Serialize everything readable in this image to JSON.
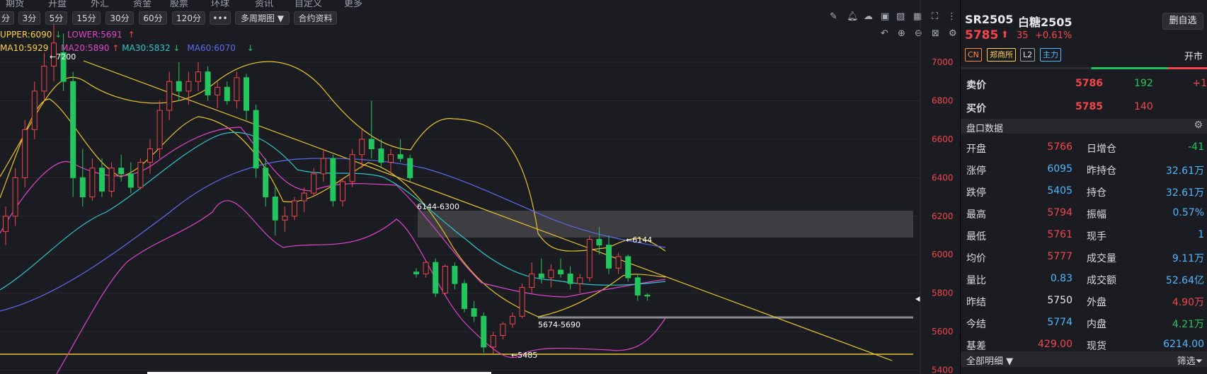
{
  "top_menu": [
    "期货",
    "开盘",
    "外汇",
    "资金",
    "股票",
    "环球",
    "资讯",
    "自定义",
    "更多"
  ],
  "toolbar": {
    "periods": [
      "分",
      "3分",
      "5分",
      "15分",
      "30分",
      "60分",
      "120分"
    ],
    "more": "•••",
    "multi_period": "多周期图 ▼",
    "contract_info": "合约资料"
  },
  "indicators": {
    "boll": [
      {
        "text": "UPPER:6090",
        "arrow": "↓",
        "color": "#ffd23f"
      },
      {
        "text": "LOWER:5691",
        "arrow": "↑",
        "color": "#e045c8"
      }
    ],
    "ma": [
      {
        "text": "MA10:5929",
        "arrow": "↓",
        "color": "#ffd23f"
      },
      {
        "text": "MA20:5890",
        "arrow": "↑",
        "color": "#e045c8"
      },
      {
        "text": "MA30:5832",
        "arrow": "↓",
        "color": "#2ec4c9"
      },
      {
        "text": "MA60:6070",
        "arrow": "↓",
        "color": "#5a6cf0"
      }
    ]
  },
  "annotations": {
    "high": "7200",
    "zone1": "6144-6300",
    "peak": "6144",
    "zone2": "5674-5690",
    "low": "5485"
  },
  "chart_data": {
    "type": "candlestick",
    "symbol": "SR2505",
    "y_axis_ticks": [
      7000,
      6800,
      6600,
      6400,
      6200,
      6000,
      5800,
      5600,
      5400
    ],
    "ylim": [
      5380,
      7250
    ],
    "candles": [
      [
        6120,
        6250,
        6050,
        6200
      ],
      [
        6200,
        6450,
        6150,
        6400
      ],
      [
        6400,
        6700,
        6350,
        6650
      ],
      [
        6650,
        6900,
        6600,
        6850
      ],
      [
        6850,
        7050,
        6800,
        6980
      ],
      [
        6980,
        7200,
        6900,
        7100
      ],
      [
        7050,
        7150,
        6850,
        6900
      ],
      [
        6900,
        6950,
        6300,
        6400
      ],
      [
        6400,
        6550,
        6250,
        6300
      ],
      [
        6300,
        6500,
        6280,
        6450
      ],
      [
        6450,
        6500,
        6300,
        6330
      ],
      [
        6330,
        6480,
        6300,
        6450
      ],
      [
        6450,
        6520,
        6380,
        6420
      ],
      [
        6420,
        6480,
        6320,
        6350
      ],
      [
        6350,
        6500,
        6340,
        6480
      ],
      [
        6480,
        6600,
        6420,
        6550
      ],
      [
        6550,
        6800,
        6500,
        6750
      ],
      [
        6750,
        6950,
        6700,
        6900
      ],
      [
        6900,
        7000,
        6800,
        6850
      ],
      [
        6850,
        6950,
        6780,
        6900
      ],
      [
        6900,
        7000,
        6850,
        6950
      ],
      [
        6950,
        6980,
        6800,
        6830
      ],
      [
        6830,
        6900,
        6760,
        6870
      ],
      [
        6870,
        6900,
        6780,
        6800
      ],
      [
        6800,
        6950,
        6760,
        6920
      ],
      [
        6920,
        6940,
        6700,
        6750
      ],
      [
        6750,
        6780,
        6400,
        6450
      ],
      [
        6450,
        6500,
        6250,
        6300
      ],
      [
        6300,
        6350,
        6100,
        6180
      ],
      [
        6180,
        6250,
        6120,
        6200
      ],
      [
        6200,
        6300,
        6180,
        6280
      ],
      [
        6280,
        6350,
        6220,
        6320
      ],
      [
        6320,
        6450,
        6300,
        6420
      ],
      [
        6420,
        6550,
        6380,
        6500
      ],
      [
        6500,
        6520,
        6250,
        6280
      ],
      [
        6280,
        6400,
        6250,
        6380
      ],
      [
        6380,
        6550,
        6350,
        6520
      ],
      [
        6520,
        6650,
        6450,
        6600
      ],
      [
        6600,
        6800,
        6500,
        6550
      ],
      [
        6550,
        6600,
        6450,
        6480
      ],
      [
        6480,
        6550,
        6420,
        6520
      ],
      [
        6520,
        6600,
        6480,
        6500
      ],
      [
        6500,
        6520,
        6380,
        6400
      ],
      [
        5910,
        5930,
        5880,
        5900
      ],
      [
        5900,
        5970,
        5880,
        5960
      ],
      [
        5960,
        5980,
        5780,
        5800
      ],
      [
        5800,
        5950,
        5790,
        5940
      ],
      [
        5940,
        5960,
        5820,
        5850
      ],
      [
        5850,
        5870,
        5700,
        5720
      ],
      [
        5720,
        5760,
        5650,
        5680
      ],
      [
        5680,
        5700,
        5490,
        5520
      ],
      [
        5520,
        5600,
        5485,
        5580
      ],
      [
        5580,
        5650,
        5560,
        5640
      ],
      [
        5640,
        5700,
        5620,
        5680
      ],
      [
        5680,
        5850,
        5670,
        5830
      ],
      [
        5830,
        5960,
        5800,
        5900
      ],
      [
        5900,
        5980,
        5850,
        5880
      ],
      [
        5880,
        5950,
        5830,
        5920
      ],
      [
        5920,
        5980,
        5880,
        5900
      ],
      [
        5900,
        5940,
        5820,
        5850
      ],
      [
        5850,
        5900,
        5800,
        5880
      ],
      [
        5880,
        6100,
        5860,
        6080
      ],
      [
        6080,
        6144,
        6000,
        6050
      ],
      [
        6050,
        6100,
        5900,
        5930
      ],
      [
        5930,
        6010,
        5900,
        5990
      ],
      [
        5990,
        6000,
        5860,
        5880
      ],
      [
        5880,
        5900,
        5760,
        5790
      ],
      [
        5790,
        5800,
        5761,
        5785
      ]
    ]
  },
  "zoom_icons": [
    "back-icon",
    "zoom-in-icon",
    "zoom-out-icon",
    "fit-icon",
    "settings-icon"
  ],
  "right_panel": {
    "code": "SR2505",
    "name": "白糖2505",
    "delete_btn": "删自选",
    "price": "5785",
    "up_arrow": "⬆",
    "change": "35",
    "change_pct": "+0.61%",
    "tags": [
      "CN",
      "郑商所",
      "L2",
      "主力"
    ],
    "market_status": "开市",
    "ask_label": "卖价",
    "ask_price": "5786",
    "ask_vol": "192",
    "ask_diff": "+1",
    "bid_label": "买价",
    "bid_price": "5785",
    "bid_vol": "140",
    "section_title": "盘口数据",
    "rows": [
      {
        "k1": "开盘",
        "v1": "5766",
        "c1": "red",
        "k2": "日增仓",
        "v2": "-41",
        "c2": "green"
      },
      {
        "k1": "涨停",
        "v1": "6095",
        "c1": "cyan",
        "k2": "昨持仓",
        "v2": "32.61万",
        "c2": "cyan"
      },
      {
        "k1": "跌停",
        "v1": "5405",
        "c1": "cyan",
        "k2": "持仓",
        "v2": "32.61万",
        "c2": "cyan"
      },
      {
        "k1": "最高",
        "v1": "5794",
        "c1": "red",
        "k2": "振幅",
        "v2": "0.57%",
        "c2": "cyan"
      },
      {
        "k1": "最低",
        "v1": "5761",
        "c1": "red",
        "k2": "现手",
        "v2": "1",
        "c2": "cyan"
      },
      {
        "k1": "均价",
        "v1": "5777",
        "c1": "red",
        "k2": "成交量",
        "v2": "9.11万",
        "c2": "cyan"
      },
      {
        "k1": "量比",
        "v1": "0.83",
        "c1": "cyan",
        "k2": "成交额",
        "v2": "52.64亿",
        "c2": "cyan"
      },
      {
        "k1": "昨结",
        "v1": "5750",
        "c1": "white",
        "k2": "外盘",
        "v2": "4.90万",
        "c2": "red"
      },
      {
        "k1": "今结",
        "v1": "5774",
        "c1": "cyan",
        "k2": "内盘",
        "v2": "4.21万",
        "c2": "green"
      },
      {
        "k1": "基差",
        "v1": "429.00",
        "c1": "red",
        "k2": "现货",
        "v2": "6214.00",
        "c2": "cyan"
      }
    ],
    "detail_tab": "全部明细 ▼",
    "filter": "筛选"
  }
}
